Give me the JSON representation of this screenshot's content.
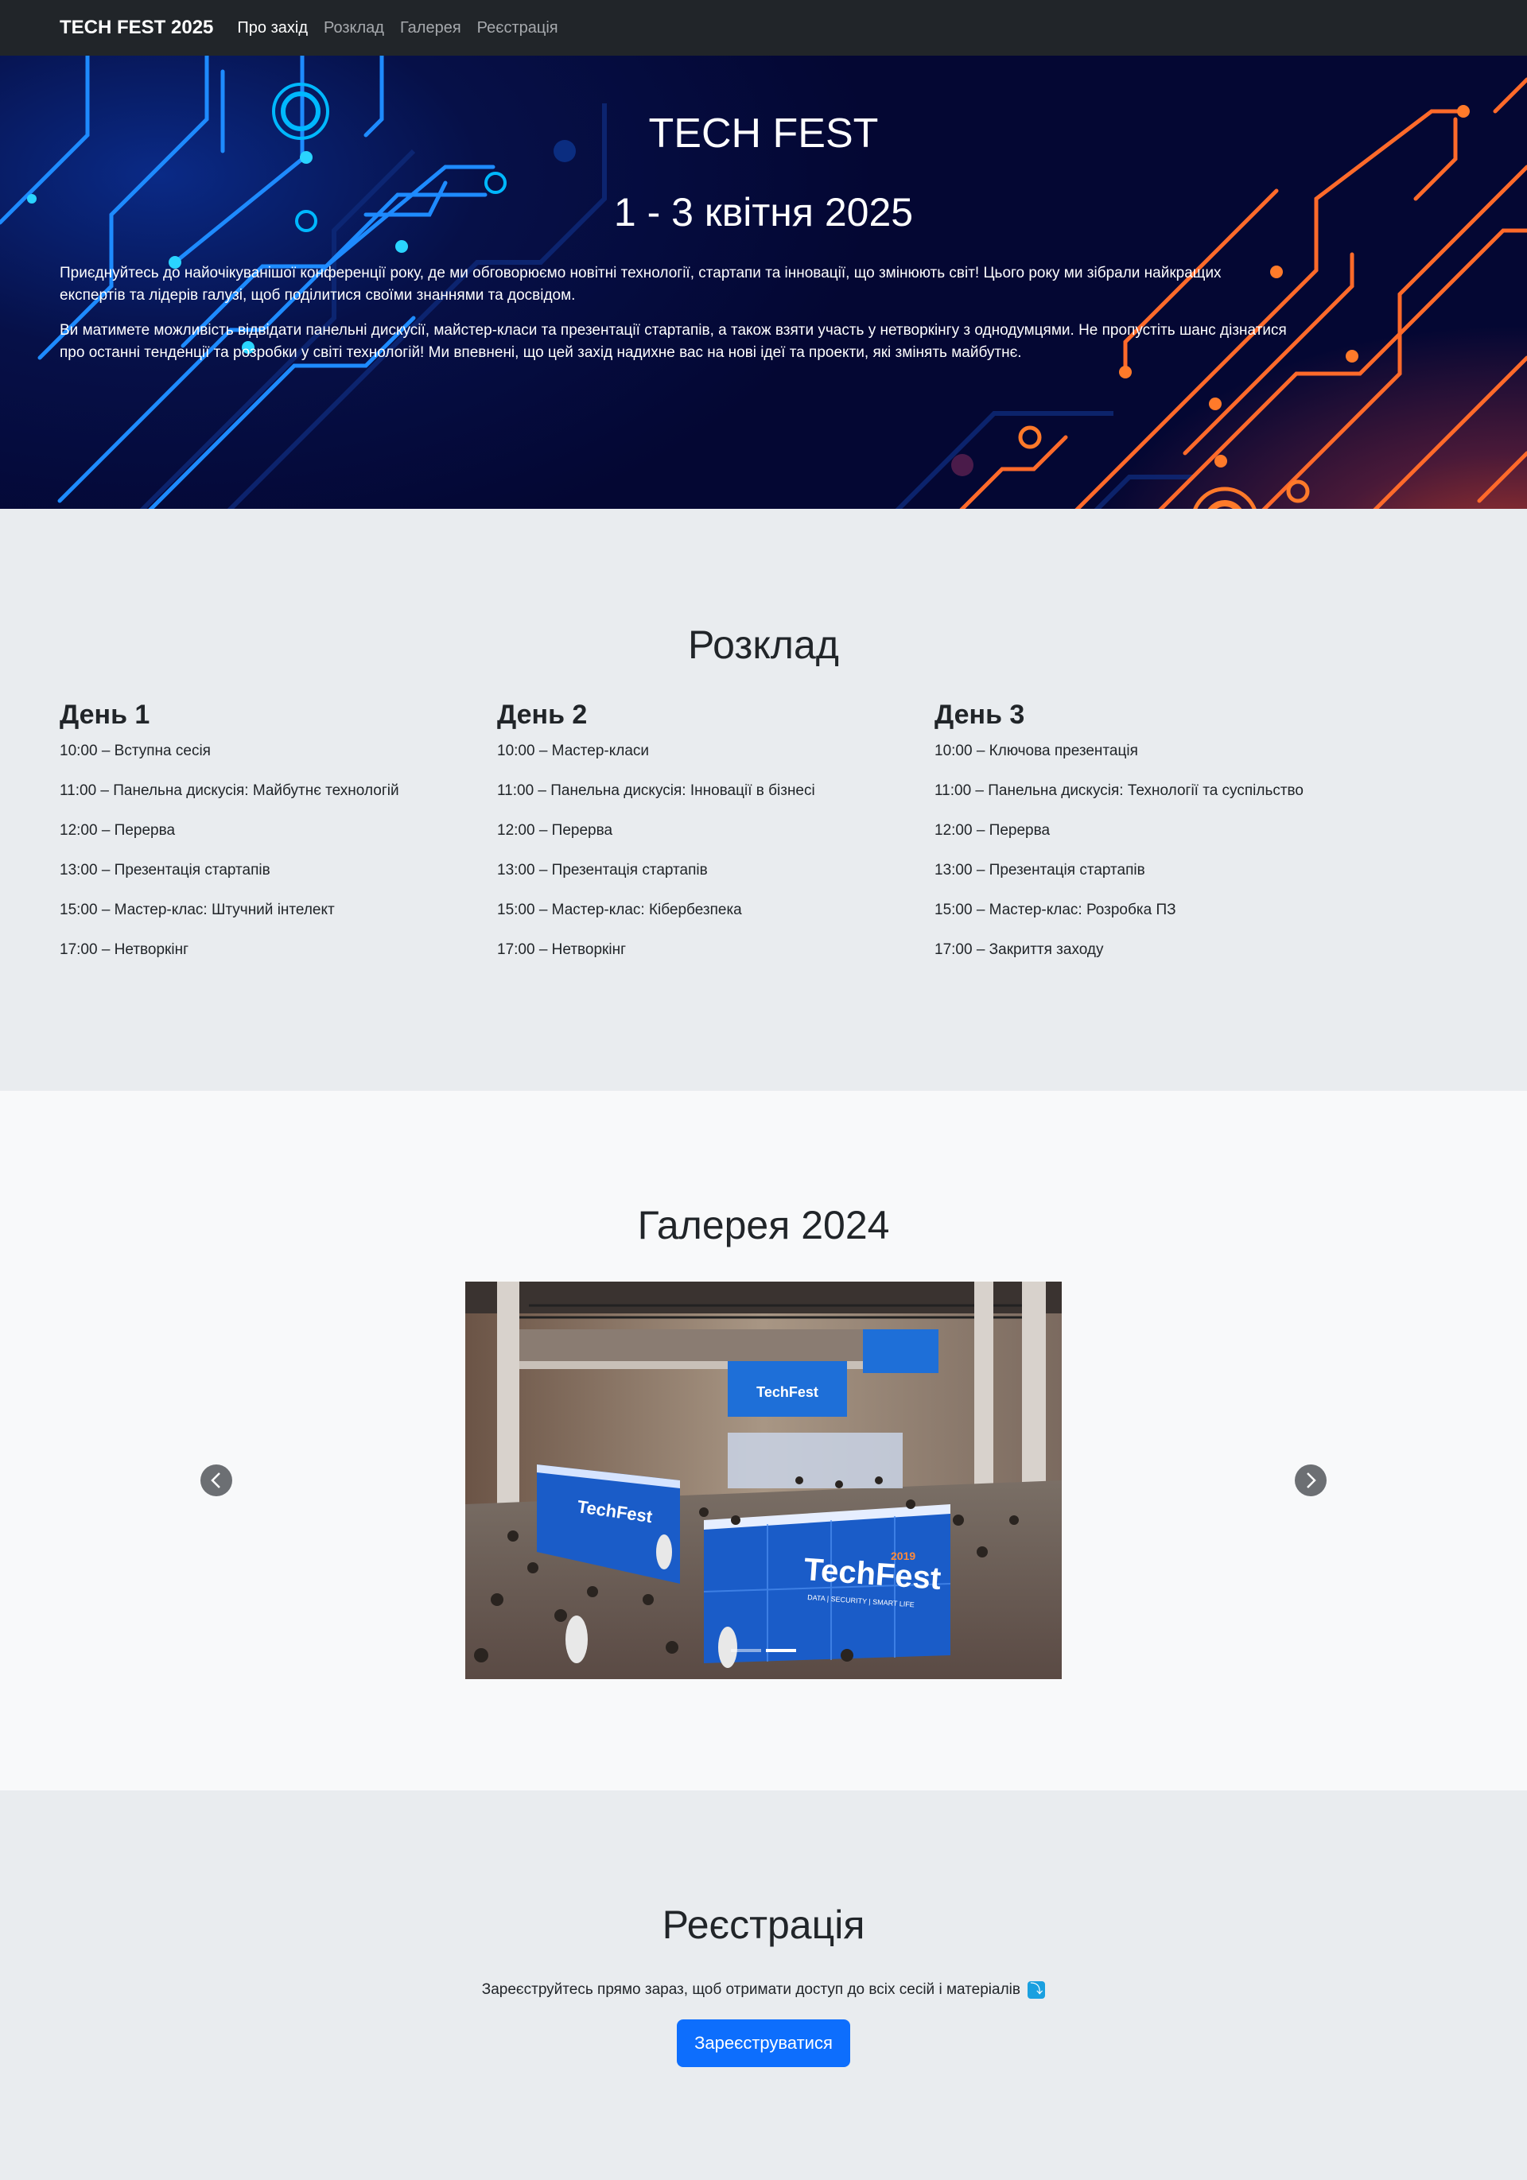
{
  "navbar": {
    "brand": "TECH FEST 2025",
    "items": [
      {
        "label": "Про захід",
        "active": true
      },
      {
        "label": "Розклад",
        "active": false
      },
      {
        "label": "Галерея",
        "active": false
      },
      {
        "label": "Реєстрація",
        "active": false
      }
    ]
  },
  "hero": {
    "title": "TECH FEST",
    "date": "1 - 3 квітня 2025",
    "paragraphs": [
      "Приєднуйтесь до найочікуванішої конференції року, де ми обговорюємо новітні технології, стартапи та інновації, що змінюють світ! Цього року ми зібрали найкращих експертів та лідерів галузі, щоб поділитися своїми знаннями та досвідом.",
      "Ви матимете можливість відвідати панельні дискусії, майстер-класи та презентації стартапів, а також взяти участь у нетворкінгу з однодумцями. Не пропустіть шанс дізнатися про останні тенденції та розробки у світі технологій! Ми впевнені, що цей захід надихне вас на нові ідеї та проекти, які змінять майбутнє."
    ],
    "bg_colors": {
      "left": "#1e8bff",
      "right": "#ff6a2a"
    }
  },
  "schedule": {
    "title": "Розклад",
    "days": [
      {
        "title": "День 1",
        "items": [
          "10:00 – Вступна сесія",
          "11:00 – Панельна дискусія: Майбутнє технологій",
          "12:00 – Перерва",
          "13:00 – Презентація стартапів",
          "15:00 – Мастер-клас: Штучний інтелект",
          "17:00 – Нетворкінг"
        ]
      },
      {
        "title": "День 2",
        "items": [
          "10:00 – Мастер-класи",
          "11:00 – Панельна дискусія: Інновації в бізнесі",
          "12:00 – Перерва",
          "13:00 – Презентація стартапів",
          "15:00 – Мастер-клас: Кібербезпека",
          "17:00 – Нетворкінг"
        ]
      },
      {
        "title": "День 3",
        "items": [
          "10:00 – Ключова презентація",
          "11:00 – Панельна дискусія: Технології та суспільство",
          "12:00 – Перерва",
          "13:00 – Презентація стартапів",
          "15:00 – Мастер-клас: Розробка ПЗ",
          "17:00 – Закриття заходу"
        ]
      }
    ]
  },
  "gallery": {
    "title": "Галерея 2024",
    "slide_count": 2,
    "active_slide": 2,
    "photo_sign_left": "TechFest",
    "photo_sign_right": "TechFest",
    "photo_sign_year": "2019",
    "photo_sign_tagline": "DATA | SECURITY | SMART LIFE",
    "photo_screen_text": "TechFest"
  },
  "registration": {
    "title": "Реєстрація",
    "text": "Зареєструйтесь прямо зараз, щоб отримати доступ до всіх сесій і матеріалів",
    "emoji": "⤵",
    "button": "Зареєструватися"
  }
}
